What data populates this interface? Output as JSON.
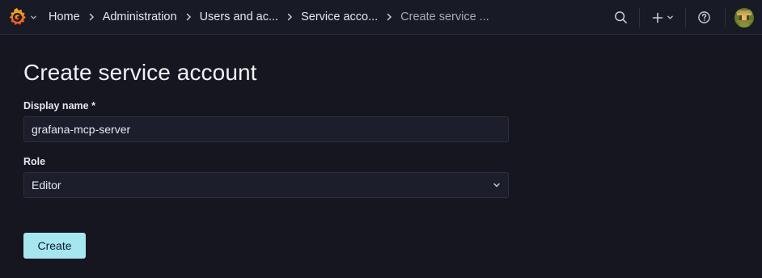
{
  "app": {
    "name": "Grafana"
  },
  "topbar": {
    "logo_icon": "grafana-logo-icon",
    "breadcrumb": [
      {
        "label": "Home"
      },
      {
        "label": "Administration"
      },
      {
        "label": "Users and ac..."
      },
      {
        "label": "Service acco..."
      },
      {
        "label": "Create service ..."
      }
    ],
    "tools": [
      "search-icon",
      "plus-icon",
      "chevron-down-icon",
      "help-icon",
      "avatar"
    ]
  },
  "page": {
    "title": "Create service account",
    "display_name_label": "Display name *",
    "display_name_value": "grafana-mcp-server",
    "role_label": "Role",
    "role_value": "Editor",
    "create_button": "Create"
  },
  "colors": {
    "background": "#15161f",
    "topbar": "#181a25",
    "input_bg": "#1c1e2b",
    "primary_button": "#a6e7ef",
    "logo_orange": "#f56e2a"
  }
}
